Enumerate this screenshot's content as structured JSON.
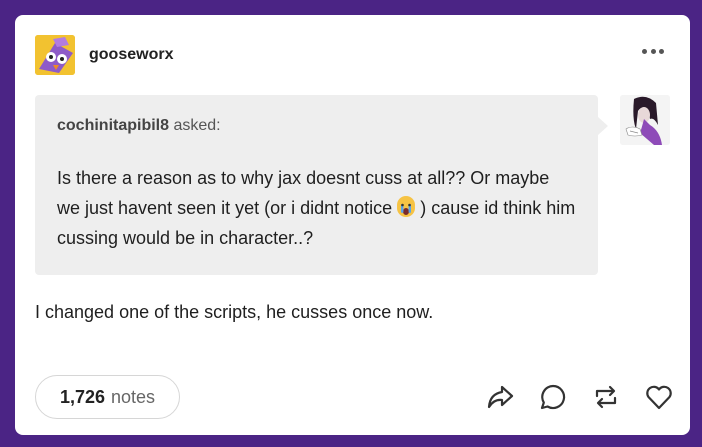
{
  "post": {
    "author": "gooseworx",
    "ask": {
      "asker": "cochinitapibil8",
      "asked_label": "asked:",
      "question_part1": "Is there a reason as to why jax doesnt cuss at all?? Or maybe we just havent seen it yet (or i didnt notice ",
      "question_emoji": "crying-emoji",
      "question_part2": ") cause id think him cussing would be in character..?"
    },
    "answer": "I changed one of the scripts, he cusses once now.",
    "notes": {
      "count": "1,726",
      "label": "notes"
    },
    "actions": [
      "share-icon",
      "reply-icon",
      "reblog-icon",
      "like-icon"
    ],
    "colors": {
      "background": "#4b2485",
      "card": "#ffffff",
      "ask_bubble": "#eeeeee",
      "icon": "#333333"
    }
  }
}
